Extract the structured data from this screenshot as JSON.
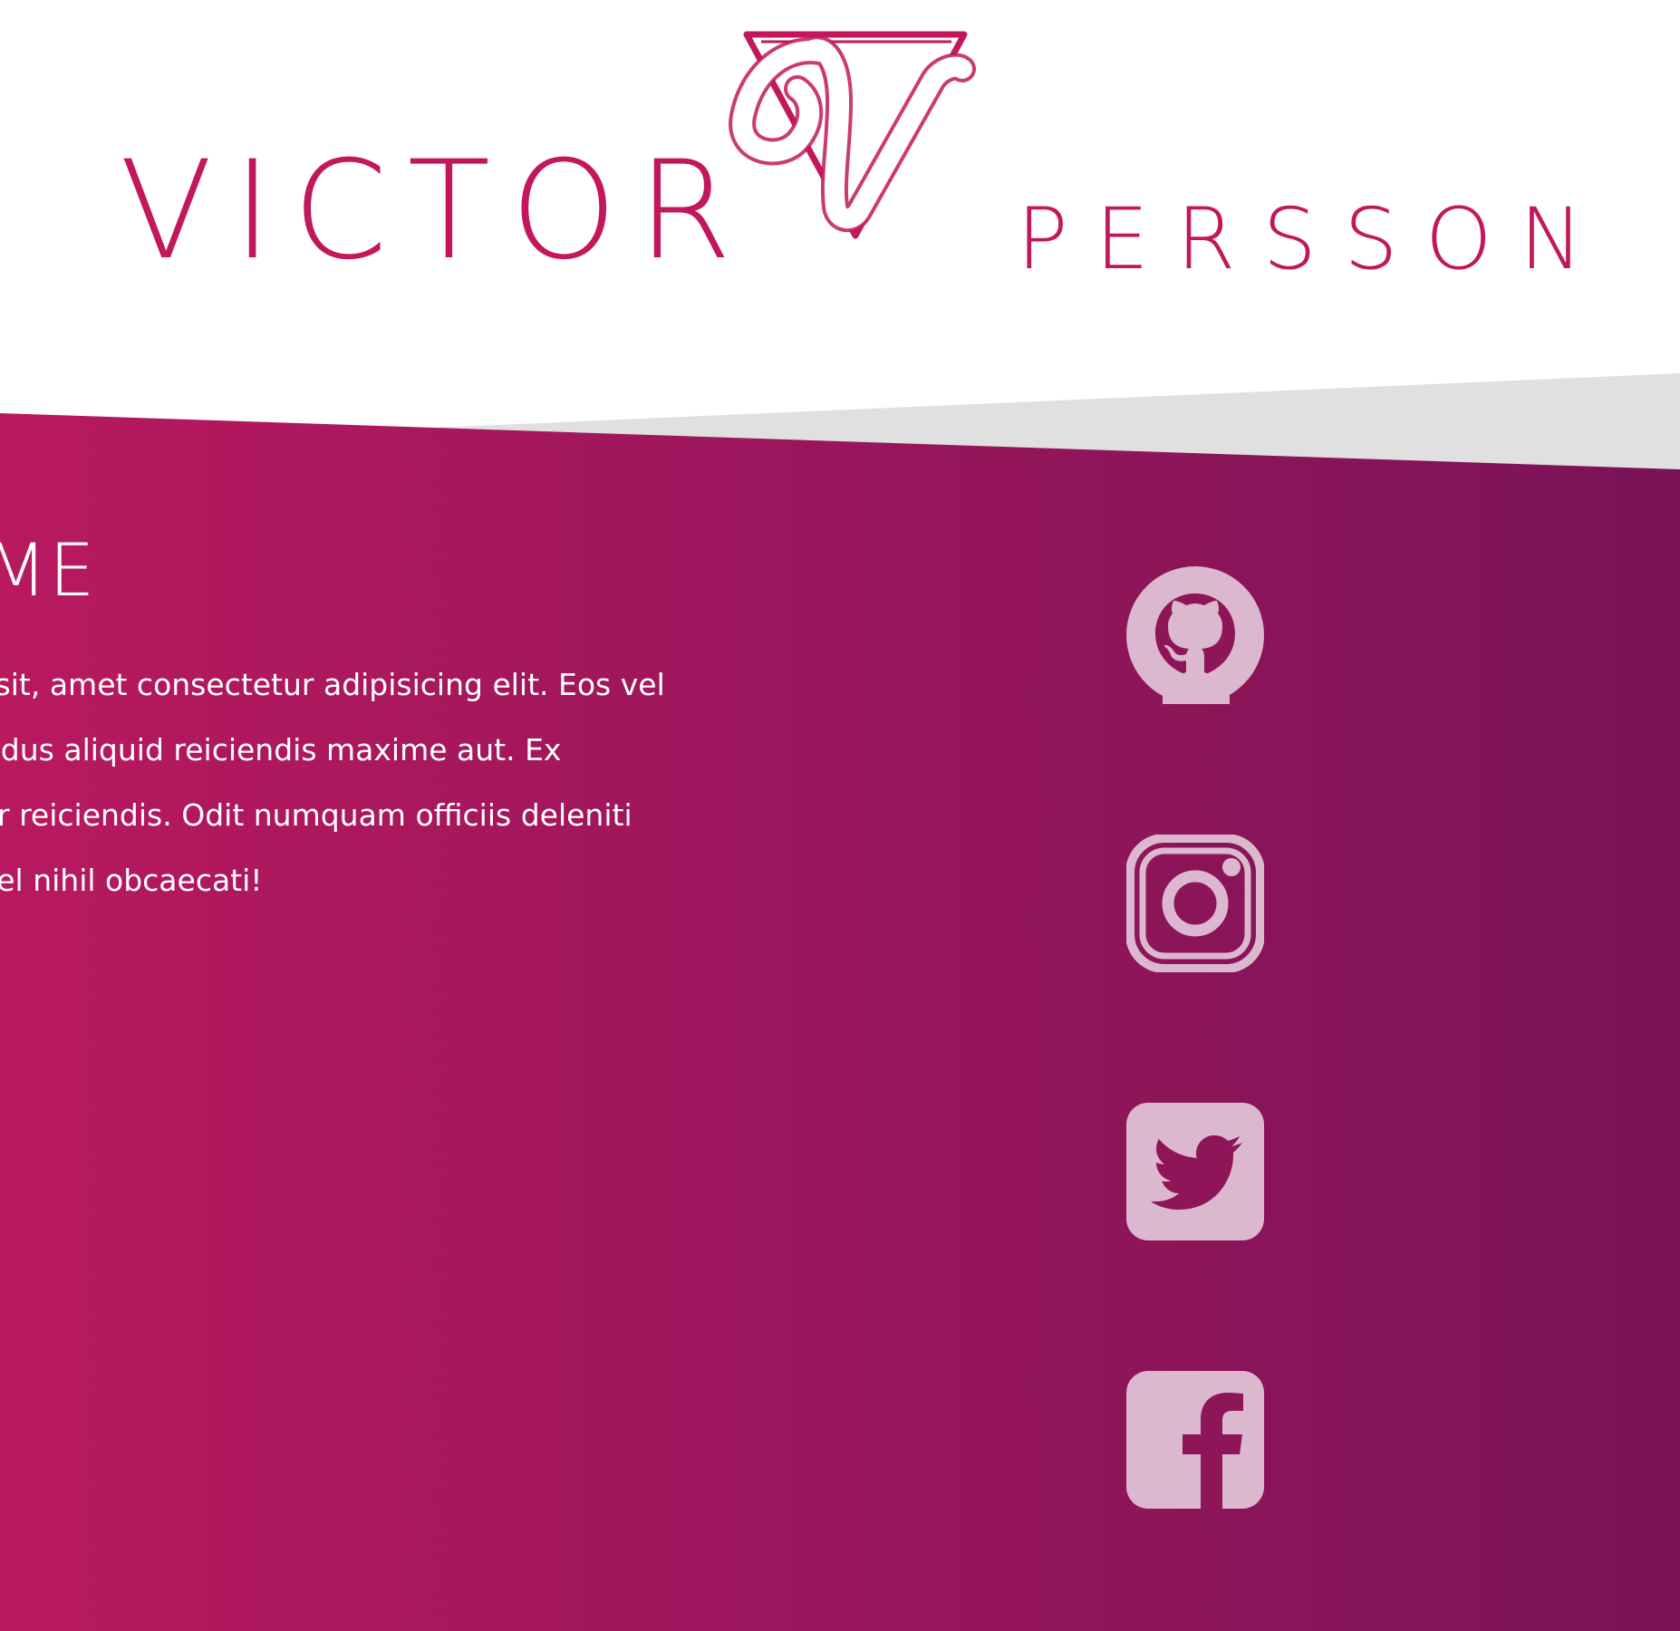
{
  "header": {
    "brand_first": "VICTOR",
    "brand_last": "PERSSON",
    "logo_icon": "v-triangle-logo-icon"
  },
  "colors": {
    "accent": "#c2185b",
    "gradient_start": "#b8195f",
    "gradient_end": "#7a1357",
    "divider_gray": "#e0e0e0",
    "icon_fill": "#dcb8cf"
  },
  "main": {
    "title": "OME",
    "body_lines": [
      "dolor sit, amet consectetur adipisicing elit. Eos vel",
      "pellendus aliquid reiciendis maxime aut. Ex",
      "ariatur reiciendis. Odit numquam officiis deleniti",
      "orro vel nihil obcaecati!"
    ]
  },
  "social": [
    {
      "name": "github",
      "icon": "github-icon"
    },
    {
      "name": "instagram",
      "icon": "instagram-icon"
    },
    {
      "name": "twitter",
      "icon": "twitter-icon"
    },
    {
      "name": "facebook",
      "icon": "facebook-icon"
    }
  ]
}
